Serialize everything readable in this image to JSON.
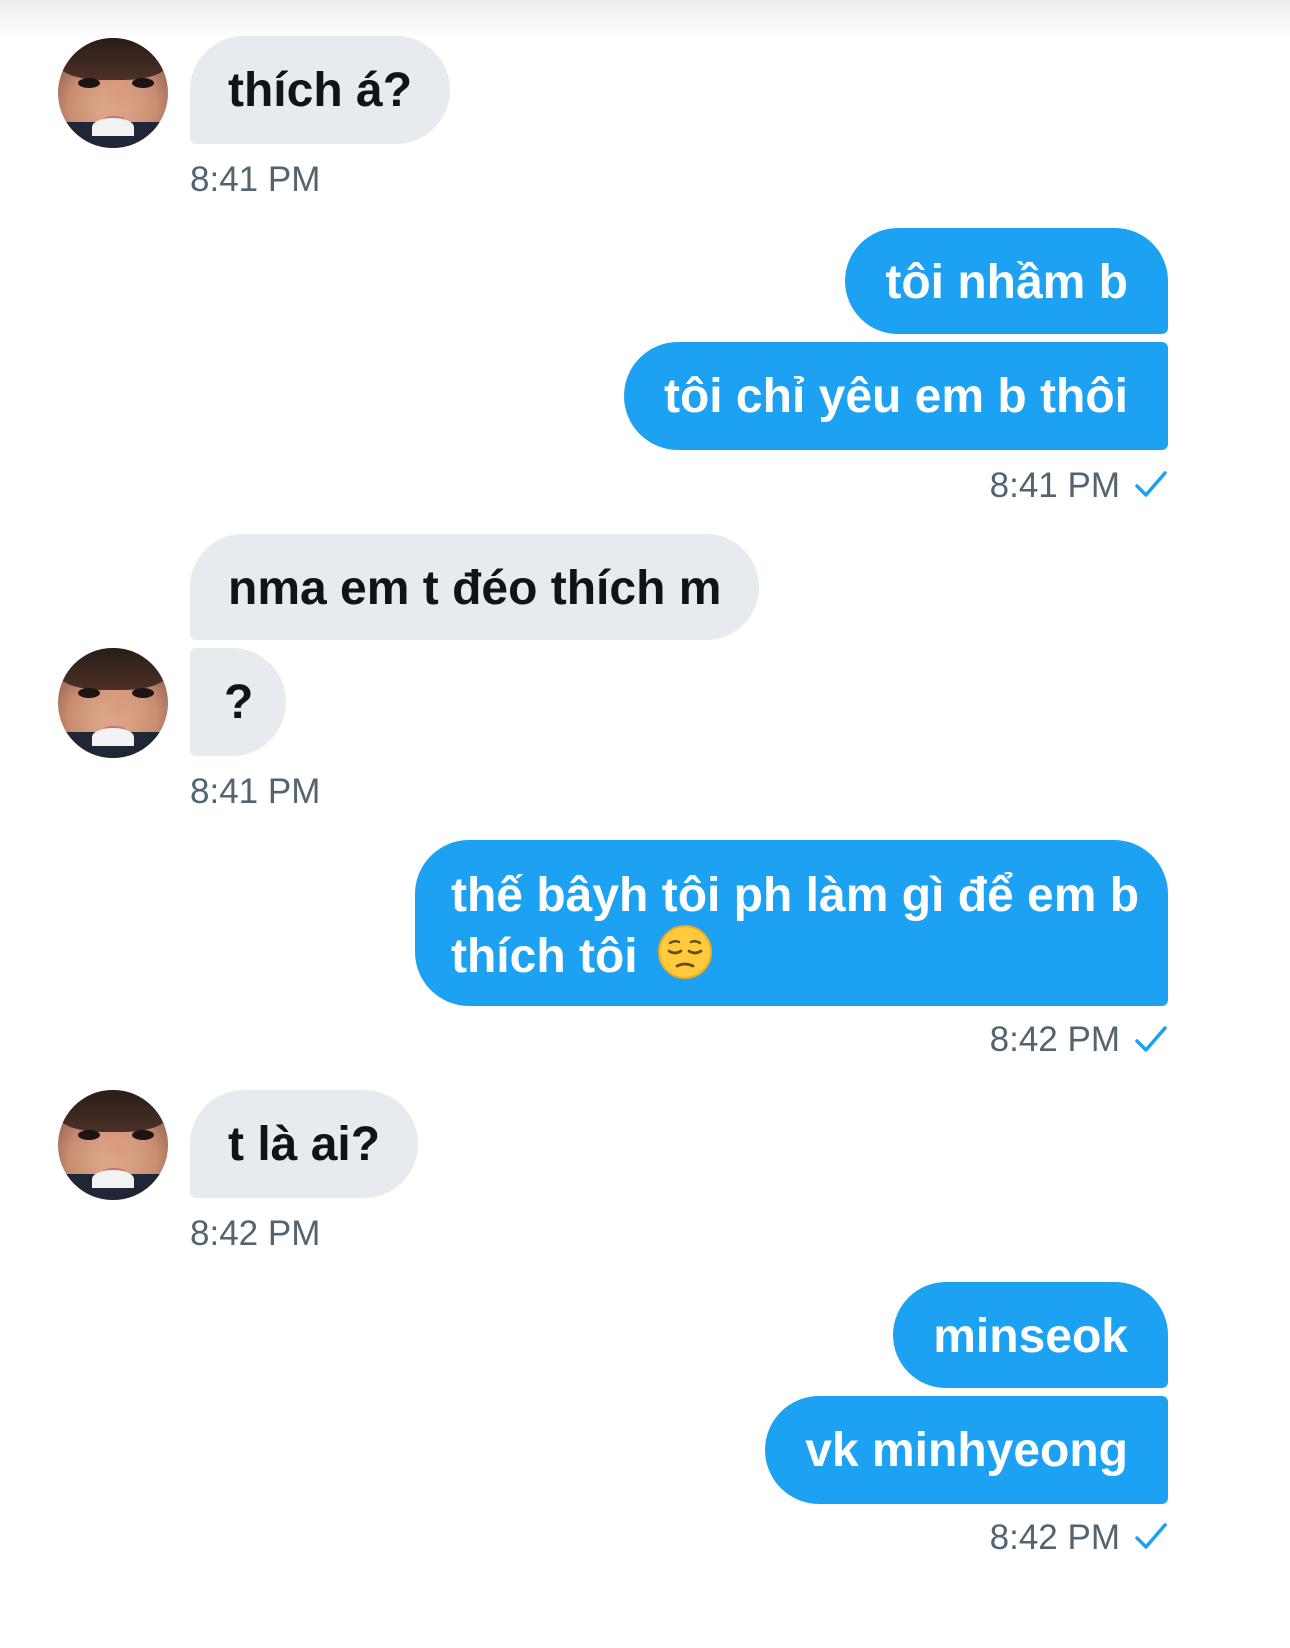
{
  "conversation": [
    {
      "from": "them",
      "text": "thích á?"
    },
    {
      "from": "them",
      "time": "8:41 PM"
    },
    {
      "from": "me",
      "text": "tôi nhầm b"
    },
    {
      "from": "me",
      "text": "tôi chỉ yêu em b thôi"
    },
    {
      "from": "me",
      "time": "8:41 PM",
      "status_icon": "read-check-icon"
    },
    {
      "from": "them",
      "text": "nma em t đéo thích m"
    },
    {
      "from": "them",
      "text": "?"
    },
    {
      "from": "them",
      "time": "8:41 PM"
    },
    {
      "from": "me",
      "text_line1": "thế bâyh tôi ph làm gì để em b",
      "text_line2": "thích tôi",
      "emoji": "pensive-face-icon"
    },
    {
      "from": "me",
      "time": "8:42 PM",
      "status_icon": "read-check-icon"
    },
    {
      "from": "them",
      "text": "t là ai?"
    },
    {
      "from": "them",
      "time": "8:42 PM"
    },
    {
      "from": "me",
      "text": "minseok"
    },
    {
      "from": "me",
      "text": "vk minhyeong"
    },
    {
      "from": "me",
      "time": "8:42 PM",
      "status_icon": "read-check-icon"
    }
  ],
  "colors": {
    "sent_bubble": "#1da1f2",
    "received_bubble": "#e7eaef",
    "timestamp": "#536471",
    "check": "#1da1f2"
  }
}
